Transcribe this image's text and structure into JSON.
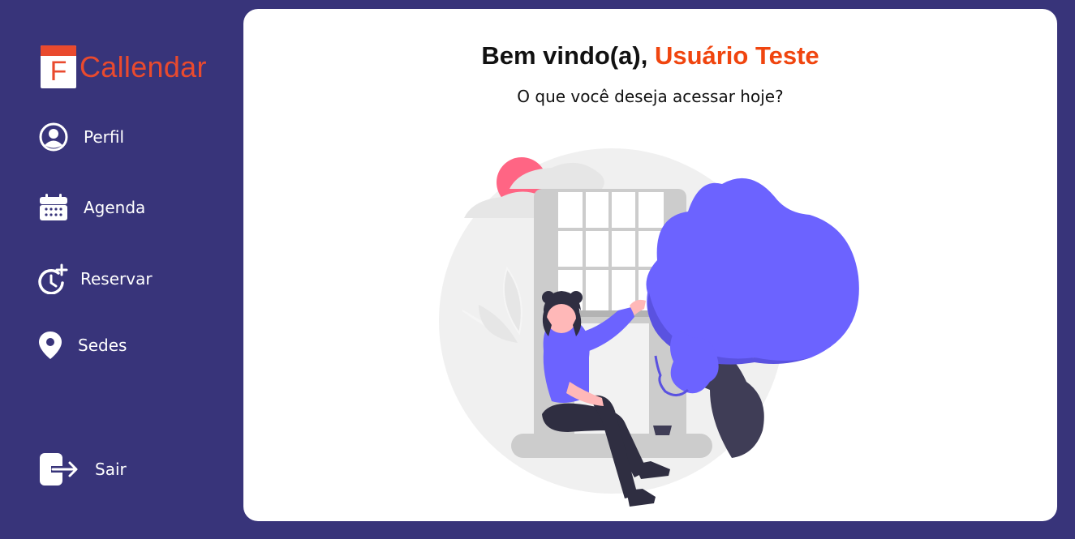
{
  "app": {
    "logo_letter": "F",
    "logo_text": "Callendar",
    "brand_color": "#e94a2e",
    "sidebar_bg": "#38347a",
    "accent": "#6c63ff"
  },
  "sidebar": {
    "items": [
      {
        "label": "Perfil",
        "icon": "user-circle-icon"
      },
      {
        "label": "Agenda",
        "icon": "calendar-icon"
      },
      {
        "label": "Reservar",
        "icon": "clock-plus-icon"
      },
      {
        "label": "Sedes",
        "icon": "map-pin-icon"
      }
    ],
    "logout": {
      "label": "Sair",
      "icon": "logout-icon"
    }
  },
  "main": {
    "greeting": "Bem vindo(a),",
    "user_name": "Usuário Teste",
    "subtitle": "O que você deseja acessar hoje?",
    "illustration": "woman-sitting-by-window-illustration"
  }
}
